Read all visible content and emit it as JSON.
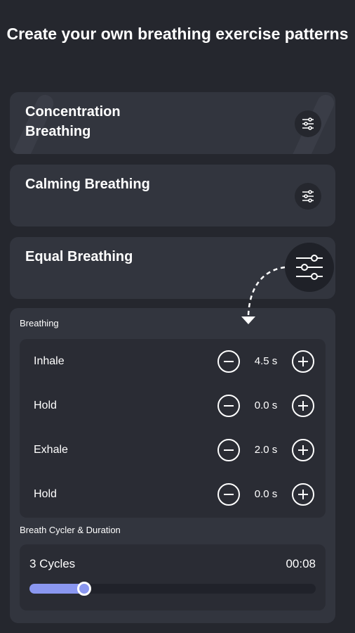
{
  "header": {
    "title": "Create your own breathing exercise patterns"
  },
  "patterns": [
    {
      "name": "Concentration Breathing"
    },
    {
      "name": "Calming Breathing"
    },
    {
      "name": "Equal Breathing"
    }
  ],
  "editor": {
    "breathing_label": "Breathing",
    "steps": [
      {
        "label": "Inhale",
        "value": "4.5 s"
      },
      {
        "label": "Hold",
        "value": "0.0 s"
      },
      {
        "label": "Exhale",
        "value": "2.0 s"
      },
      {
        "label": "Hold",
        "value": "0.0 s"
      }
    ],
    "cycle_section_label": "Breath Cycler & Duration",
    "cycles_text": "3 Cycles",
    "duration_text": "00:08",
    "slider_fraction": 0.19
  },
  "icons": [
    "tune-icon",
    "minus-icon",
    "plus-icon",
    "dashed-arrow-icon"
  ],
  "colors": {
    "background": "#25272e",
    "card": "#32353e",
    "accent": "#8a97f0",
    "text": "#ffffff"
  }
}
